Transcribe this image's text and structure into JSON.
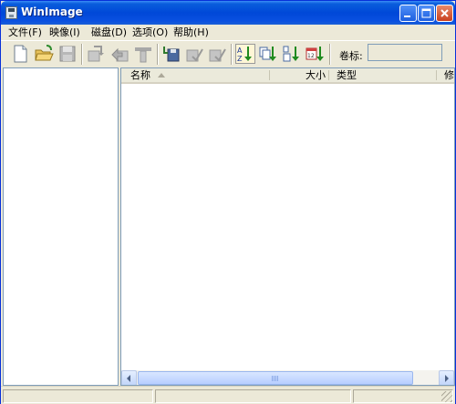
{
  "window": {
    "title": "WinImage"
  },
  "menu": [
    {
      "label": "文件(F)"
    },
    {
      "label": "映像(I)"
    },
    {
      "label": "磁盘(D)"
    },
    {
      "label": "选项(O)"
    },
    {
      "label": "帮助(H)"
    }
  ],
  "toolbar": {
    "icons": [
      "new-icon",
      "open-icon",
      "save-icon",
      "extract-icon",
      "inject-icon",
      "tool-icon",
      "disk-read-icon",
      "disk-write-icon",
      "disk-check-icon",
      "sort-name-icon",
      "sort-ext-icon",
      "sort-size-icon",
      "sort-date-icon"
    ],
    "volume_label": "卷标:",
    "volume_value": ""
  },
  "file_list": {
    "columns": [
      {
        "label": "名称"
      },
      {
        "label": "大小"
      },
      {
        "label": "类型"
      },
      {
        "label": "修"
      }
    ],
    "rows": []
  },
  "colors": {
    "titlebar": "#0a5ddc",
    "chrome": "#ece9d8",
    "border": "#7f9db9"
  }
}
